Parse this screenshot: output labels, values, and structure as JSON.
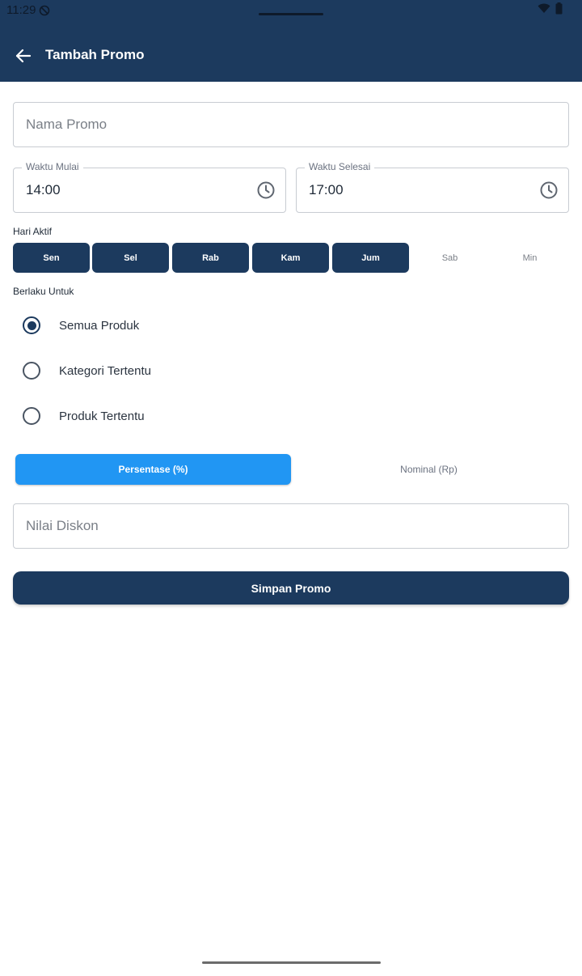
{
  "status_bar": {
    "time": "11:29"
  },
  "appbar": {
    "title": "Tambah Promo"
  },
  "form": {
    "promo_name": {
      "placeholder": "Nama Promo",
      "value": ""
    },
    "start_time": {
      "label": "Waktu Mulai",
      "value": "14:00"
    },
    "end_time": {
      "label": "Waktu Selesai",
      "value": "17:00"
    },
    "active_days_label": "Hari Aktif",
    "days": [
      {
        "label": "Sen",
        "selected": true
      },
      {
        "label": "Sel",
        "selected": true
      },
      {
        "label": "Rab",
        "selected": true
      },
      {
        "label": "Kam",
        "selected": true
      },
      {
        "label": "Jum",
        "selected": true
      },
      {
        "label": "Sab",
        "selected": false
      },
      {
        "label": "Min",
        "selected": false
      }
    ],
    "applies_to_label": "Berlaku Untuk",
    "applies_to_options": [
      {
        "label": "Semua Produk",
        "selected": true
      },
      {
        "label": "Kategori Tertentu",
        "selected": false
      },
      {
        "label": "Produk Tertentu",
        "selected": false
      }
    ],
    "discount_type": [
      {
        "label": "Persentase (%)",
        "selected": true
      },
      {
        "label": "Nominal (Rp)",
        "selected": false
      }
    ],
    "discount_value": {
      "placeholder": "Nilai Diskon",
      "value": ""
    },
    "save_label": "Simpan Promo"
  },
  "colors": {
    "primary": "#1c3a5e",
    "accent": "#2196f3"
  },
  "icons": {
    "back": "arrow-left-icon",
    "clock": "clock-icon",
    "wifi": "wifi-icon",
    "battery": "battery-icon"
  }
}
